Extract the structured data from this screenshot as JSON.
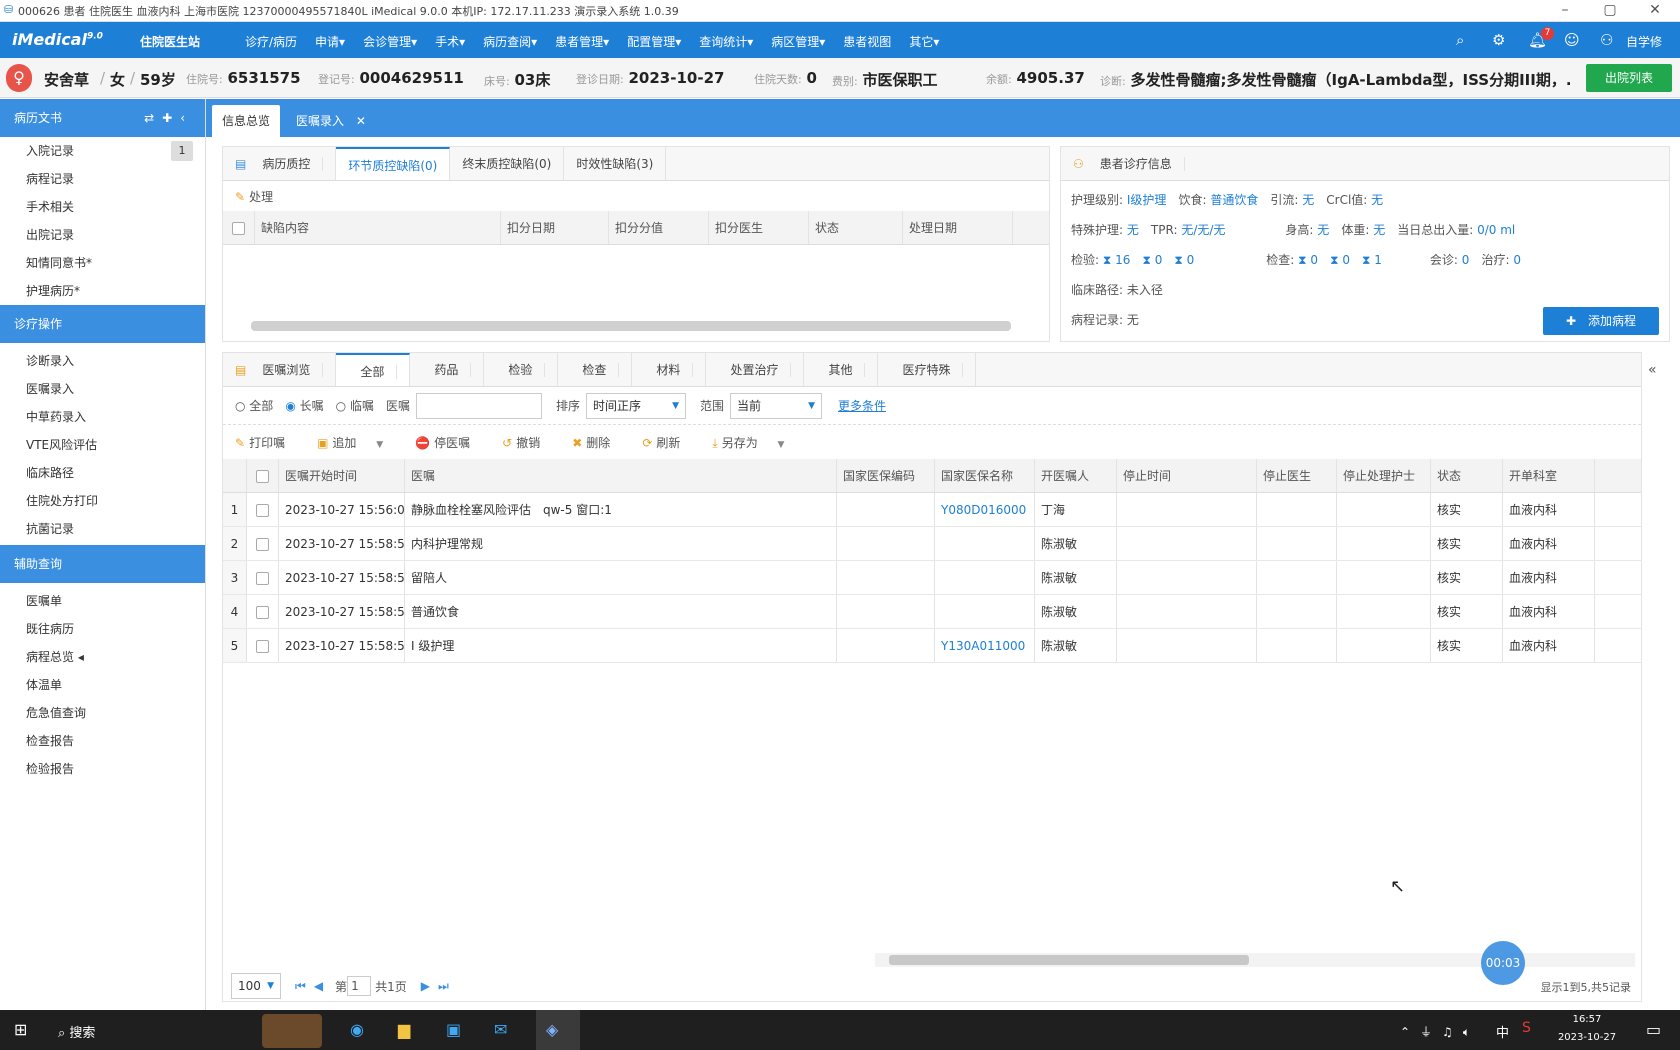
{
  "titlebar": {
    "text": "000626 患者 住院医生 血液内科 上海市医院 12370000495571840L iMedical 9.0.0 本机IP: 172.17.11.233 演示录入系统 1.0.39"
  },
  "appbar": {
    "logo": "iMedical",
    "logo_suffix": "9.0",
    "subtitle": "住院医生站",
    "menu": [
      "诊疗/病历",
      "申请▾",
      "会诊管理▾",
      "手术▾",
      "病历查阅▾",
      "患者管理▾",
      "配置管理▾",
      "查询统计▾",
      "病区管理▾",
      "患者视图",
      "其它▾"
    ],
    "notif_count": "7",
    "user": "自学修"
  },
  "patient": {
    "name": "安舍草",
    "sex": "女",
    "age": "59岁",
    "inpatient_label": "住院号:",
    "inpatient_no": "6531575",
    "reg_label": "登记号:",
    "reg_no": "0004629511",
    "bed_label": "床号:",
    "bed": "03床",
    "admit_label": "登诊日期:",
    "admit_date": "2023-10-27",
    "days_label": "住院天数:",
    "days": "0",
    "fee_label": "费别:",
    "fee_type": "市医保职工",
    "balance_label": "余额:",
    "balance": "4905.37",
    "diag_label": "诊断:",
    "diagnosis": "多发性骨髓瘤;多发性骨髓瘤（IgA-Lambda型，ISS分期III期，...",
    "action_button": "出院列表"
  },
  "sidebar": {
    "section1": "病历文书",
    "items1": [
      {
        "label": "入院记录",
        "count": "1"
      },
      {
        "label": "病程记录"
      },
      {
        "label": "手术相关"
      },
      {
        "label": "出院记录"
      },
      {
        "label": "知情同意书*"
      },
      {
        "label": "护理病历*"
      }
    ],
    "section2": "诊疗操作",
    "items2": [
      "诊断录入",
      "医嘱录入",
      "中草药录入",
      "VTE风险评估",
      "临床路径",
      "住院处方打印",
      "抗菌记录"
    ],
    "section3": "辅助查询",
    "items3": [
      "医嘱单",
      "既往病历",
      "病程总览 ◂",
      "体温单",
      "危急值查询",
      "检查报告",
      "检验报告"
    ]
  },
  "maintabs": [
    {
      "label": "信息总览"
    },
    {
      "label": "医嘱录入"
    }
  ],
  "quality": {
    "tabs": [
      "病历质控",
      "环节质控缺陷(0)",
      "终末质控缺陷(0)",
      "时效性缺陷(3)"
    ],
    "action": "处理",
    "columns": [
      "缺陷内容",
      "扣分日期",
      "扣分分值",
      "扣分医生",
      "状态",
      "处理日期"
    ]
  },
  "diaginfo": {
    "title": "患者诊疗信息",
    "nursing_label": "护理级别:",
    "nursing": "I级护理",
    "diet_label": "饮食:",
    "diet": "普通饮食",
    "drain_label": "引流:",
    "drain": "无",
    "cr_label": "CrCl值:",
    "cr": "无",
    "special_label": "特殊护理:",
    "special": "无",
    "tpr_label": "TPR:",
    "tpr": "无/无/无",
    "height_label": "身高:",
    "height": "无",
    "weight_label": "体重:",
    "weight": "无",
    "io_label": "当日总出入量:",
    "io": "0/0 ml",
    "lab_label": "检验:",
    "lab": [
      "16",
      "0",
      "0"
    ],
    "exam_label": "检查:",
    "exam": [
      "0",
      "0",
      "1"
    ],
    "consult_label": "会诊:",
    "consult": "0",
    "treat_label": "治疗:",
    "treat": "0",
    "path_label": "临床路径:",
    "path": "未入径",
    "record_label": "病程记录:",
    "record": "无",
    "add_button": "添加病程"
  },
  "orders": {
    "tabs": [
      "医嘱浏览",
      "全部",
      "药品",
      "检验",
      "检查",
      "材料",
      "处置治疗",
      "其他",
      "医疗特殊"
    ],
    "filter": {
      "radios": [
        "全部",
        "长嘱",
        "临嘱"
      ],
      "name_label": "医嘱",
      "sort_label": "排序",
      "sort_value": "时间正序",
      "scope_label": "范围",
      "scope_value": "当前",
      "more": "更多条件"
    },
    "toolbar": [
      "打印嘱",
      "追加",
      "停医嘱",
      "撤销",
      "删除",
      "刷新",
      "另存为"
    ],
    "columns": [
      "医嘱开始时间",
      "医嘱",
      "国家医保编码",
      "国家医保名称",
      "开医嘱人",
      "停止时间",
      "停止医生",
      "停止处理护士",
      "状态",
      "开单科室"
    ],
    "rows": [
      {
        "n": "1",
        "start": "2023-10-27 15:56:0",
        "order": "静脉血栓栓塞风险评估　qw-5 窗口:1",
        "code": "",
        "insname": "Y080D016000",
        "doctor": "丁海",
        "stop": "",
        "stopdoc": "",
        "nurse": "",
        "status": "核实",
        "dept": "血液内科"
      },
      {
        "n": "2",
        "start": "2023-10-27 15:58:5",
        "order": "内科护理常规",
        "code": "",
        "insname": "",
        "doctor": "陈淑敏",
        "stop": "",
        "stopdoc": "",
        "nurse": "",
        "status": "核实",
        "dept": "血液内科"
      },
      {
        "n": "3",
        "start": "2023-10-27 15:58:5",
        "order": "留陪人",
        "code": "",
        "insname": "",
        "doctor": "陈淑敏",
        "stop": "",
        "stopdoc": "",
        "nurse": "",
        "status": "核实",
        "dept": "血液内科"
      },
      {
        "n": "4",
        "start": "2023-10-27 15:58:5",
        "order": "普通饮食",
        "code": "",
        "insname": "",
        "doctor": "陈淑敏",
        "stop": "",
        "stopdoc": "",
        "nurse": "",
        "status": "核实",
        "dept": "血液内科"
      },
      {
        "n": "5",
        "start": "2023-10-27 15:58:5",
        "order": "I 级护理",
        "code": "",
        "insname": "Y130A011000",
        "doctor": "陈淑敏",
        "stop": "",
        "stopdoc": "",
        "nurse": "",
        "status": "核实",
        "dept": "血液内科"
      }
    ],
    "pager": {
      "size": "100",
      "page_prefix": "第",
      "page": "1",
      "total": "共1页",
      "summary": "显示1到5,共5记录"
    },
    "timer": "00:03"
  },
  "taskbar": {
    "search": "搜索",
    "time": "16:57",
    "date": "2023-10-27",
    "ime": "中"
  }
}
